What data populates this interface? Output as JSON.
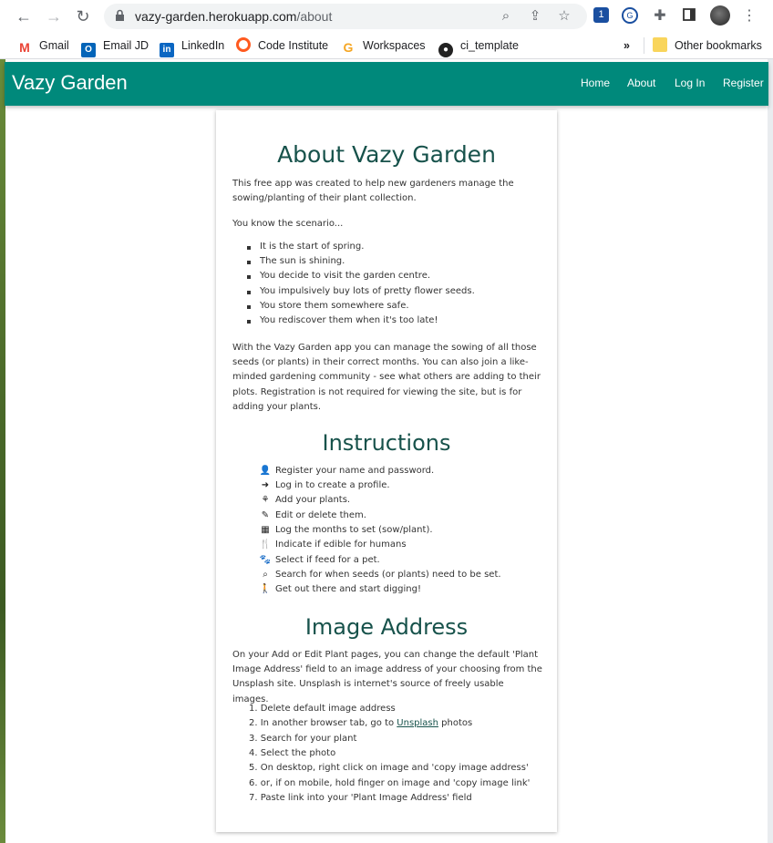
{
  "browser": {
    "url_host": "vazy-garden.herokuapp.com",
    "url_path": "/about",
    "bookmarks": [
      "Gmail",
      "Email JD",
      "LinkedIn",
      "Code Institute",
      "Workspaces",
      "ci_template"
    ],
    "overflow": "»",
    "other_bookmarks": "Other bookmarks"
  },
  "nav": {
    "brand": "Vazy Garden",
    "links": [
      "Home",
      "About",
      "Log In",
      "Register"
    ],
    "color": "#00897b"
  },
  "about": {
    "title": "About Vazy Garden",
    "intro": "This free app was created to help new gardeners manage the sowing/planting of their plant collection.",
    "scenario_label": "You know the scenario...",
    "scenario": [
      "It is the start of spring.",
      "The sun is shining.",
      "You decide to visit the garden centre.",
      "You impulsively buy lots of pretty flower seeds.",
      "You store them somewhere safe.",
      "You rediscover them when it's too late!"
    ],
    "summary": "With the Vazy Garden app you can manage the sowing of all those seeds (or plants) in their correct months. You can also join a like-minded gardening community - see what others are adding to their plots. Registration is not required for viewing the site, but is for adding your plants."
  },
  "instructions": {
    "title": "Instructions",
    "items": [
      {
        "icon": "user-edit-icon",
        "text": "Register your name and password."
      },
      {
        "icon": "sign-in-icon",
        "text": "Log in to create a profile."
      },
      {
        "icon": "seedling-icon",
        "text": "Add your plants."
      },
      {
        "icon": "pencil-icon",
        "text": "Edit or delete them."
      },
      {
        "icon": "calendar-icon",
        "text": "Log the months to set (sow/plant)."
      },
      {
        "icon": "utensils-icon",
        "text": "Indicate if edible for humans"
      },
      {
        "icon": "paw-icon",
        "text": "Select if feed for a pet."
      },
      {
        "icon": "search-icon",
        "text": "Search for when seeds (or plants) need to be set."
      },
      {
        "icon": "hiking-icon",
        "text": "Get out there and start digging!"
      }
    ]
  },
  "image_address": {
    "title": "Image Address",
    "intro": "On your Add or Edit Plant pages, you can change the default 'Plant Image Address' field to an image address of your choosing from the Unsplash site. Unsplash is internet's source of freely usable images.",
    "steps": [
      {
        "pre": "Delete default image address",
        "link": "",
        "post": ""
      },
      {
        "pre": "In another browser tab, go to ",
        "link": "Unsplash",
        "post": " photos"
      },
      {
        "pre": "Search for your plant",
        "link": "",
        "post": ""
      },
      {
        "pre": "Select the photo",
        "link": "",
        "post": ""
      },
      {
        "pre": "On desktop, right click on image and 'copy image address'",
        "link": "",
        "post": ""
      },
      {
        "pre": "or, if on mobile, hold finger on image and 'copy image link'",
        "link": "",
        "post": ""
      },
      {
        "pre": "Paste link into your 'Plant Image Address' field",
        "link": "",
        "post": ""
      }
    ]
  }
}
